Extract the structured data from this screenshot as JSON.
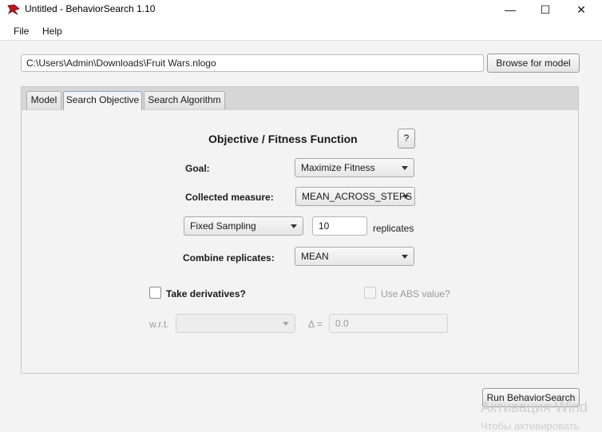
{
  "window": {
    "title": "Untitled - BehaviorSearch 1.10",
    "minimize_glyph": "—",
    "maximize_glyph": "☐",
    "close_glyph": "✕"
  },
  "menu": {
    "items": [
      "File",
      "Help"
    ]
  },
  "model_path": {
    "value": "C:\\Users\\Admin\\Downloads\\Fruit Wars.nlogo"
  },
  "browse_button": {
    "label": "Browse for model"
  },
  "tabs": [
    {
      "label": "Model",
      "selected": false
    },
    {
      "label": "Search Objective",
      "selected": true
    },
    {
      "label": "Search Algorithm",
      "selected": false
    }
  ],
  "objective": {
    "heading": "Objective / Fitness Function",
    "help_label": "?",
    "goal_label": "Goal:",
    "goal_value": "Maximize Fitness",
    "collected_label": "Collected measure:",
    "collected_value": "MEAN_ACROSS_STEPS",
    "sampling_value": "Fixed Sampling",
    "replicates_value": "10",
    "replicates_label": "replicates",
    "combine_label": "Combine replicates:",
    "combine_value": "MEAN",
    "derivatives_label": "Take derivatives?",
    "derivatives_checked": false,
    "abs_label": "Use ABS value?",
    "abs_checked": false,
    "wrt_label": "w.r.t.",
    "wrt_value": "",
    "delta_label": "Δ =",
    "delta_value": "0.0"
  },
  "run_button": {
    "label": "Run BehaviorSearch"
  },
  "watermark": {
    "line1": "Активация Wind",
    "line2": "Чтобы активировать"
  },
  "colors": {
    "tab_selected_border": "#7fa7d6",
    "app_icon": "#c0171d"
  }
}
